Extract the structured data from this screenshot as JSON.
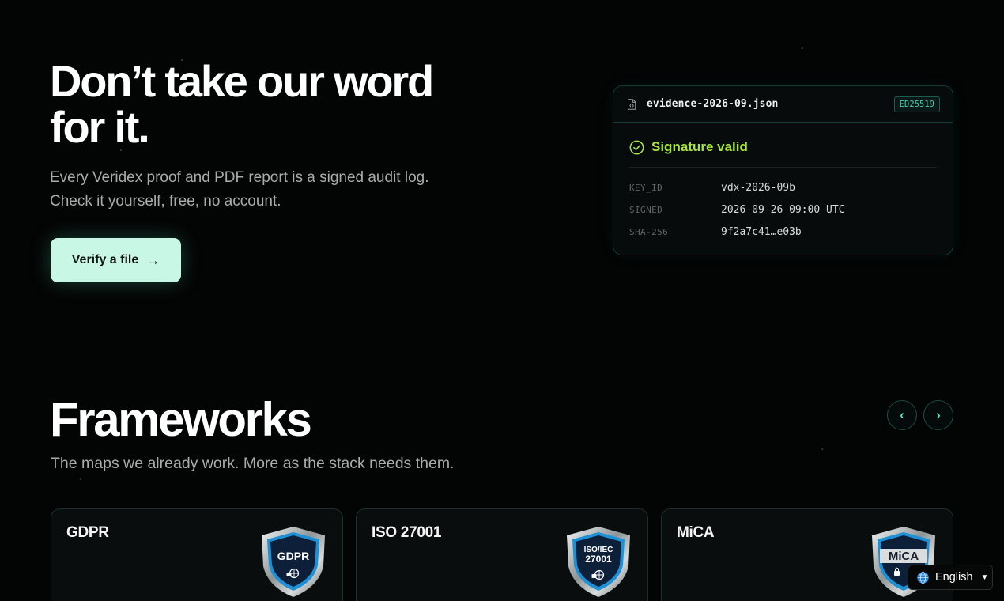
{
  "hero": {
    "title": "Don’t take our word for it.",
    "subtitle": "Every Veridex proof and PDF report is a signed audit log. Check it yourself, free, no account.",
    "cta_label": "Verify a file",
    "cta_icon": "arrow-right-icon"
  },
  "evidence": {
    "file_icon": "file-code-icon",
    "filename": "evidence-2026-09.json",
    "algorithm_badge": "ED25519",
    "status_icon": "check-circle-icon",
    "status": "Signature valid",
    "fields": [
      {
        "key": "KEY_ID",
        "value": "vdx-2026-09b"
      },
      {
        "key": "SIGNED",
        "value": "2026-09-26 09:00 UTC"
      },
      {
        "key": "SHA-256",
        "value": "9f2a7c41…e03b"
      }
    ]
  },
  "frameworks": {
    "title": "Frameworks",
    "subtitle": "The maps we already work. More as the stack needs them.",
    "prev_icon": "chevron-left-icon",
    "next_icon": "chevron-right-icon",
    "cards": [
      {
        "name": "GDPR",
        "badge_lines": [
          "GDPR"
        ]
      },
      {
        "name": "ISO 27001",
        "badge_lines": [
          "ISO/IEC",
          "27001"
        ]
      },
      {
        "name": "MiCA",
        "badge_lines": [
          "MiCA"
        ]
      }
    ]
  },
  "language": {
    "label": "English",
    "icon": "globe-icon"
  },
  "colors": {
    "background": "#030404",
    "accent": "#5ee0c2",
    "cta_fill": "#c9f7e6",
    "valid": "#a7e63c",
    "badge_blue": "#1e90d6"
  }
}
